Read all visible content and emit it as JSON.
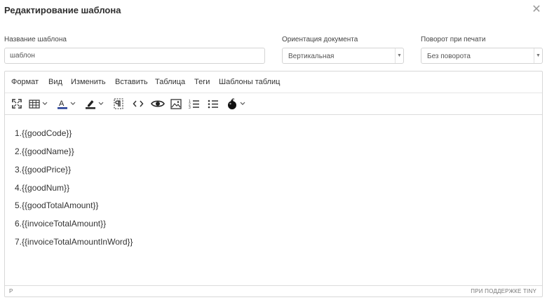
{
  "dialog": {
    "title": "Редактирование шаблона"
  },
  "fields": {
    "name": {
      "label": "Название шаблона",
      "value": "шаблон"
    },
    "orientation": {
      "label": "Ориентация документа",
      "selected": "Вертикальная"
    },
    "rotation": {
      "label": "Поворот при печати",
      "selected": "Без поворота"
    }
  },
  "editor": {
    "menu": [
      "Формат",
      "Вид",
      "Изменить",
      "Вставить",
      "Таблица",
      "Теги",
      "Шаблоны таблиц"
    ],
    "toolbar_icons": [
      "fullscreen-icon",
      "table-icon",
      "text-color-icon",
      "highlight-color-icon",
      "page-break-icon",
      "source-code-icon",
      "preview-icon",
      "image-icon",
      "numbered-list-icon",
      "bullet-list-icon",
      "bomb-icon"
    ],
    "lines": [
      "1.{{goodCode}}",
      "2.{{goodName}}",
      "3.{{goodPrice}}",
      "4.{{goodNum}}",
      "5.{{goodTotalAmount}}",
      "6.{{invoiceTotalAmount}}",
      "7.{{invoiceTotalAmountInWord}}"
    ],
    "status": {
      "path": "P",
      "brand": "ПРИ ПОДДЕРЖКЕ TINY"
    }
  },
  "colors": {
    "accent_text_color": "#1f3a93",
    "highlight": "#f5c518"
  }
}
